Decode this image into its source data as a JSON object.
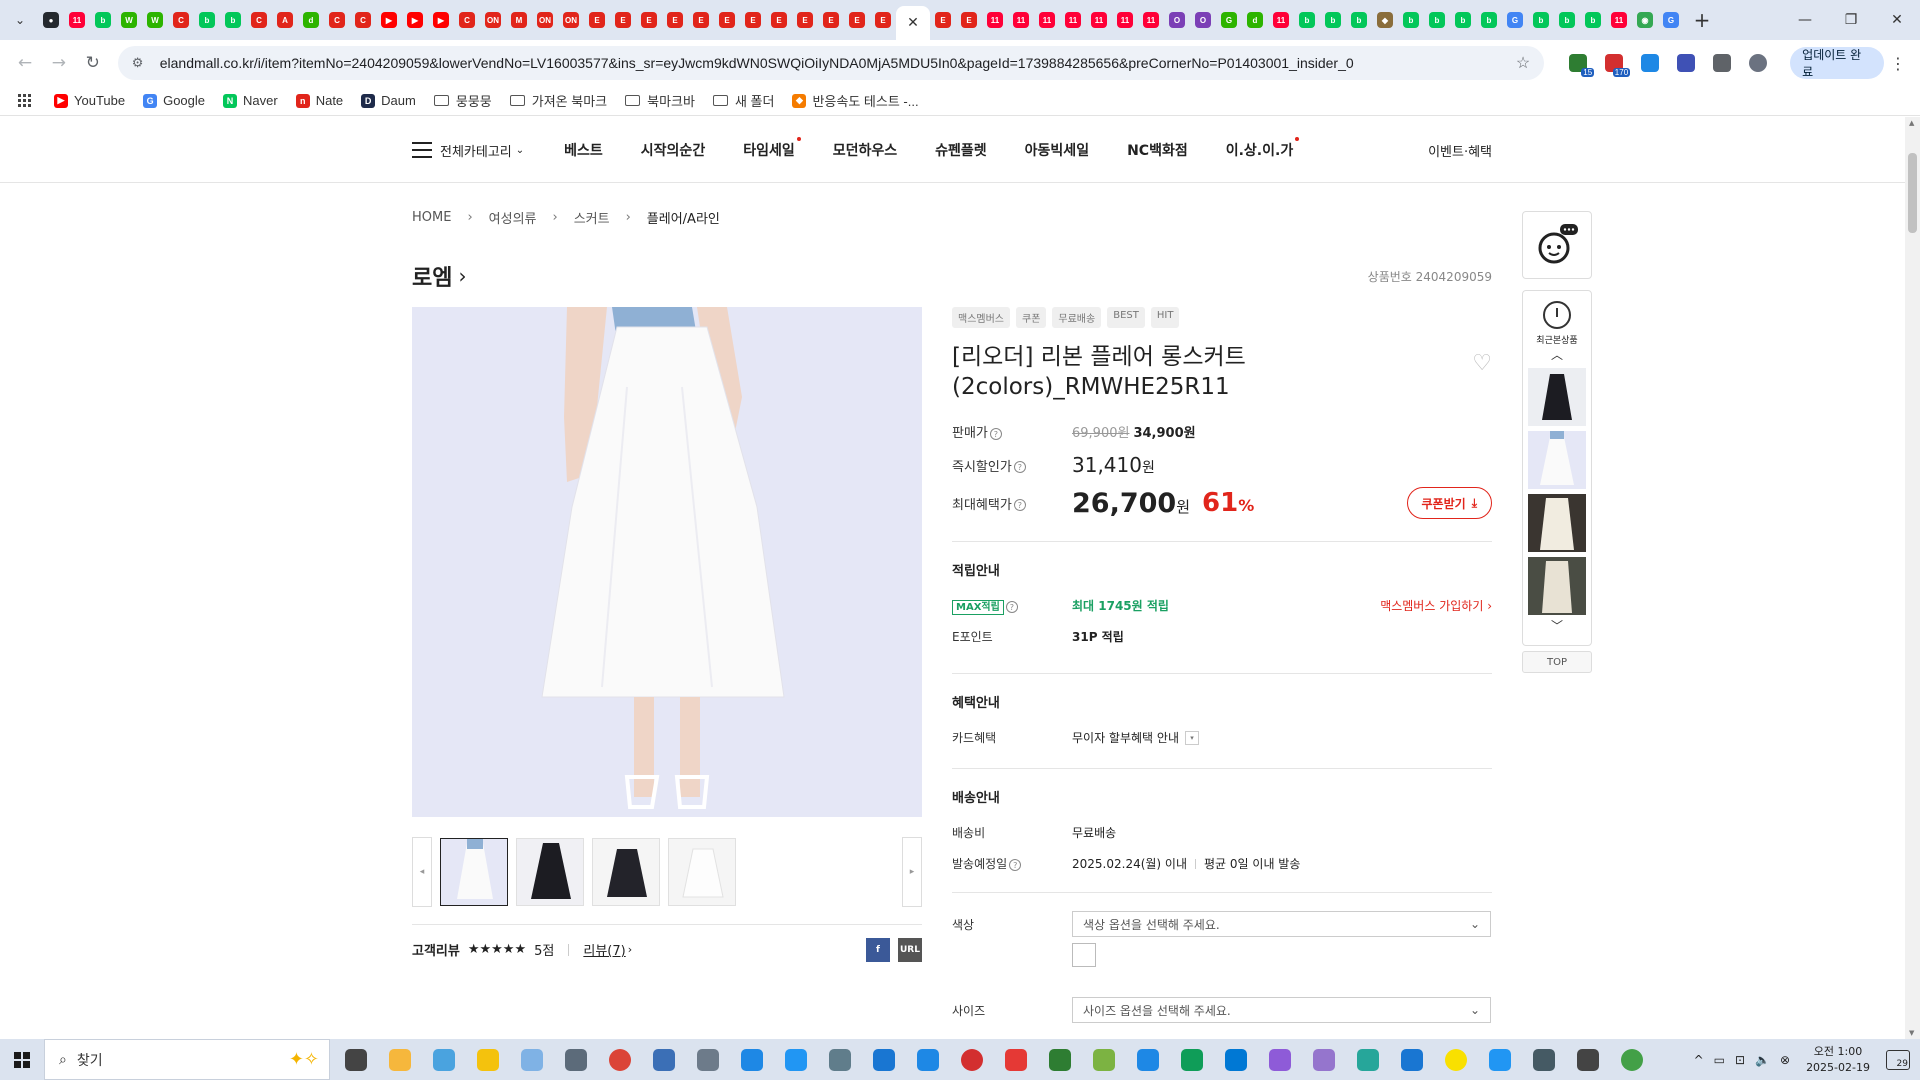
{
  "browser": {
    "tabs": [
      {
        "icon": "github-icon",
        "color": "#24292f",
        "active": false
      },
      {
        "icon": "11st-icon",
        "color": "#ff0038",
        "active": false
      },
      {
        "icon": "naver-blog-icon",
        "color": "#03c75a",
        "active": false
      },
      {
        "icon": "w-icon",
        "color": "#2db400",
        "active": false
      },
      {
        "icon": "w-icon",
        "color": "#2db400",
        "active": false
      },
      {
        "icon": "c-icon",
        "color": "#e1251b",
        "active": false
      },
      {
        "icon": "naver-blog-icon",
        "color": "#03c75a",
        "active": false
      },
      {
        "icon": "naver-blog-icon",
        "color": "#03c75a",
        "active": false
      },
      {
        "icon": "c-icon",
        "color": "#e1251b",
        "active": false
      },
      {
        "icon": "a-icon",
        "color": "#e1251b",
        "active": false
      },
      {
        "icon": "d-icon",
        "color": "#2db400",
        "active": false
      },
      {
        "icon": "c-icon",
        "color": "#e1251b",
        "active": false
      },
      {
        "icon": "c-icon",
        "color": "#e1251b",
        "active": false
      },
      {
        "icon": "youtube-icon",
        "color": "#ff0000",
        "active": false
      },
      {
        "icon": "youtube-icon",
        "color": "#ff0000",
        "active": false
      },
      {
        "icon": "youtube-icon",
        "color": "#ff0000",
        "active": false
      },
      {
        "icon": "c-icon",
        "color": "#e1251b",
        "active": false
      },
      {
        "icon": "on-icon",
        "color": "#e1251b",
        "active": false
      },
      {
        "icon": "m-icon",
        "color": "#e1251b",
        "active": false
      },
      {
        "icon": "on-icon",
        "color": "#e1251b",
        "active": false
      },
      {
        "icon": "on-icon",
        "color": "#e1251b",
        "active": false
      },
      {
        "icon": "elandmall-icon",
        "color": "#e1251b",
        "active": false
      },
      {
        "icon": "elandmall-icon",
        "color": "#e1251b",
        "active": false
      },
      {
        "icon": "elandmall-icon",
        "color": "#e1251b",
        "active": false
      },
      {
        "icon": "elandmall-icon",
        "color": "#e1251b",
        "active": false
      },
      {
        "icon": "elandmall-icon",
        "color": "#e1251b",
        "active": false
      },
      {
        "icon": "elandmall-icon",
        "color": "#e1251b",
        "active": false
      },
      {
        "icon": "elandmall-icon",
        "color": "#e1251b",
        "active": false
      },
      {
        "icon": "elandmall-icon",
        "color": "#e1251b",
        "active": false
      },
      {
        "icon": "elandmall-icon",
        "color": "#e1251b",
        "active": false
      },
      {
        "icon": "elandmall-icon",
        "color": "#e1251b",
        "active": false
      },
      {
        "icon": "elandmall-icon",
        "color": "#e1251b",
        "active": false
      },
      {
        "icon": "elandmall-icon",
        "color": "#e1251b",
        "active": false
      },
      {
        "icon": "close-icon",
        "color": "#333333",
        "active": true
      },
      {
        "icon": "elandmall-icon",
        "color": "#e1251b",
        "active": false
      },
      {
        "icon": "elandmall-icon",
        "color": "#e1251b",
        "active": false
      },
      {
        "icon": "11st-icon",
        "color": "#ff0038",
        "active": false
      },
      {
        "icon": "11st-icon",
        "color": "#ff0038",
        "active": false
      },
      {
        "icon": "11st-icon",
        "color": "#ff0038",
        "active": false
      },
      {
        "icon": "11st-icon",
        "color": "#ff0038",
        "active": false
      },
      {
        "icon": "11st-icon",
        "color": "#ff0038",
        "active": false
      },
      {
        "icon": "11st-icon",
        "color": "#ff0038",
        "active": false
      },
      {
        "icon": "11st-icon",
        "color": "#ff0038",
        "active": false
      },
      {
        "icon": "o-icon",
        "color": "#7b3fb6",
        "active": false
      },
      {
        "icon": "o-icon",
        "color": "#7b3fb6",
        "active": false
      },
      {
        "icon": "g-icon",
        "color": "#2db400",
        "active": false
      },
      {
        "icon": "d-icon",
        "color": "#2db400",
        "active": false
      },
      {
        "icon": "11st-icon",
        "color": "#ff0038",
        "active": false
      },
      {
        "icon": "naver-blog-icon",
        "color": "#03c75a",
        "active": false
      },
      {
        "icon": "naver-blog-icon",
        "color": "#03c75a",
        "active": false
      },
      {
        "icon": "naver-blog-icon",
        "color": "#03c75a",
        "active": false
      },
      {
        "icon": "owl-icon",
        "color": "#8a6d3b",
        "active": false
      },
      {
        "icon": "naver-blog-icon",
        "color": "#03c75a",
        "active": false
      },
      {
        "icon": "naver-blog-icon",
        "color": "#03c75a",
        "active": false
      },
      {
        "icon": "naver-blog-icon",
        "color": "#03c75a",
        "active": false
      },
      {
        "icon": "naver-blog-icon",
        "color": "#03c75a",
        "active": false
      },
      {
        "icon": "google-icon",
        "color": "#4285f4",
        "active": false
      },
      {
        "icon": "naver-blog-icon",
        "color": "#03c75a",
        "active": false
      },
      {
        "icon": "naver-blog-icon",
        "color": "#03c75a",
        "active": false
      },
      {
        "icon": "naver-blog-icon",
        "color": "#03c75a",
        "active": false
      },
      {
        "icon": "11st-icon",
        "color": "#ff0038",
        "active": false
      },
      {
        "icon": "maps-icon",
        "color": "#34a853",
        "active": false
      },
      {
        "icon": "google-icon",
        "color": "#4285f4",
        "active": false
      }
    ],
    "new_tab": "+",
    "window_controls": {
      "minimize": "—",
      "restore": "❐",
      "close": "✕"
    },
    "url": "elandmall.co.kr/i/item?itemNo=2404209059&lowerVendNo=LV16003577&ins_sr=eyJwcm9kdWN0SWQiOiIyNDA0MjA5MDU5In0&pageId=1739884285656&preCornerNo=P01403001_insider_0",
    "extensions": [
      {
        "icon": "ext-green-icon",
        "badge": "15",
        "color": "#2e7d32"
      },
      {
        "icon": "ext-red-icon",
        "badge": "170",
        "color": "#d32f2f"
      },
      {
        "icon": "ext-blue-icon",
        "badge": "",
        "color": "#1e88e5"
      },
      {
        "icon": "ext-translate-icon",
        "badge": "",
        "color": "#3f51b5"
      },
      {
        "icon": "puzzle-icon",
        "badge": "",
        "color": "#5f6368"
      },
      {
        "icon": "profile-icon",
        "badge": "",
        "color": "#5f6368"
      }
    ],
    "update_label": "업데이트 완료",
    "bookmarks": [
      {
        "label": "YouTube",
        "icon": "youtube-icon",
        "color": "#ff0000",
        "folder": false
      },
      {
        "label": "Google",
        "icon": "google-icon",
        "color": "#4285f4",
        "folder": false
      },
      {
        "label": "Naver",
        "icon": "naver-icon",
        "color": "#03c75a",
        "folder": false
      },
      {
        "label": "Nate",
        "icon": "nate-icon",
        "color": "#e1251b",
        "folder": false
      },
      {
        "label": "Daum",
        "icon": "daum-icon",
        "color": "#1e2a4a",
        "folder": false
      },
      {
        "label": "뭉뭉뭉",
        "icon": "folder-icon",
        "color": "",
        "folder": true
      },
      {
        "label": "가져온 북마크",
        "icon": "folder-icon",
        "color": "",
        "folder": true
      },
      {
        "label": "북마크바",
        "icon": "folder-icon",
        "color": "",
        "folder": true
      },
      {
        "label": "새 폴더",
        "icon": "folder-icon",
        "color": "",
        "folder": true
      },
      {
        "label": "반응속도 테스트 -...",
        "icon": "fox-icon",
        "color": "#f57c00",
        "folder": false
      }
    ]
  },
  "site": {
    "nav": {
      "all_category": "전체카테고리",
      "items": [
        {
          "label": "베스트",
          "dot": false
        },
        {
          "label": "시작의순간",
          "dot": false
        },
        {
          "label": "타임세일",
          "dot": true
        },
        {
          "label": "모던하우스",
          "dot": false
        },
        {
          "label": "슈펜플렛",
          "dot": false
        },
        {
          "label": "아동빅세일",
          "dot": false
        },
        {
          "label": "NC백화점",
          "dot": false
        },
        {
          "label": "이.상.이.가",
          "dot": true
        }
      ],
      "event": "이벤트·혜택"
    },
    "breadcrumb": [
      "HOME",
      "여성의류",
      "스커트",
      "플레어/A라인"
    ],
    "brand": "로엠",
    "product_no": "상품번호 2404209059",
    "tags": [
      "맥스멤버스",
      "쿠폰",
      "무료배송",
      "BEST",
      "HIT"
    ],
    "product_name": "[리오더] 리본 플레어 롱스커트 (2colors)_RMWHE25R11",
    "price": {
      "sale_label": "판매가",
      "original": "69,900원",
      "sale": "34,900원",
      "instant_label": "즉시할인가",
      "instant_value": "31,410",
      "instant_unit": "원",
      "max_label": "최대혜택가",
      "max_value": "26,700",
      "max_unit": "원",
      "discount_value": "61",
      "discount_unit": "%",
      "coupon_btn": "쿠폰받기"
    },
    "points": {
      "title": "적립안내",
      "max_badge": "MAX적립",
      "max_text": "최대 1745원 적립",
      "join_link": "맥스멤버스 가입하기",
      "epoint_label": "E포인트",
      "epoint_value": "31P 적립"
    },
    "benefit": {
      "title": "혜택안내",
      "card_label": "카드혜택",
      "card_value": "무이자 할부혜택 안내"
    },
    "delivery": {
      "title": "배송안내",
      "fee_label": "배송비",
      "fee_value": "무료배송",
      "date_label": "발송예정일",
      "date_value": "2025.02.24(월) 이내",
      "date_avg": "평균 0일 이내 발송"
    },
    "options": {
      "color_label": "색상",
      "color_placeholder": "색상 옵션을 선택해 주세요.",
      "size_label": "사이즈",
      "size_placeholder": "사이즈 옵션을 선택해 주세요."
    },
    "review": {
      "label": "고객리뷰",
      "rating": 5,
      "stars": "★★★★★",
      "score": "5점",
      "link": "리뷰(7)"
    },
    "share": [
      {
        "icon": "facebook-icon",
        "label": "f",
        "color": "#3b5998"
      },
      {
        "icon": "url-icon",
        "label": "URL",
        "color": "#555555"
      }
    ],
    "recent_label": "최근본상품",
    "top_label": "TOP"
  },
  "taskbar": {
    "search_placeholder": "찾기",
    "apps": [
      {
        "icon": "task-view-icon",
        "color": "#444444"
      },
      {
        "icon": "file-explorer-icon",
        "color": "#f6b73c"
      },
      {
        "icon": "app-icon",
        "color": "#4aa3df"
      },
      {
        "icon": "media-player-icon",
        "color": "#f4c20d"
      },
      {
        "icon": "paint-icon",
        "color": "#7fb2e5"
      },
      {
        "icon": "calculator-icon",
        "color": "#5c6b7a"
      },
      {
        "icon": "chrome-icon",
        "color": "#db4437"
      },
      {
        "icon": "app-icon",
        "color": "#3b6fb6"
      },
      {
        "icon": "app-icon",
        "color": "#6d7b8a"
      },
      {
        "icon": "app-icon",
        "color": "#1e88e5"
      },
      {
        "icon": "app-icon",
        "color": "#2196f3"
      },
      {
        "icon": "app-icon",
        "color": "#607d8b"
      },
      {
        "icon": "app-icon",
        "color": "#1976d2"
      },
      {
        "icon": "app-icon",
        "color": "#1e88e5"
      },
      {
        "icon": "record-icon",
        "color": "#d32f2f"
      },
      {
        "icon": "app-icon",
        "color": "#e53935"
      },
      {
        "icon": "app-icon",
        "color": "#2e7d32"
      },
      {
        "icon": "app-icon",
        "color": "#7cb342"
      },
      {
        "icon": "app-icon",
        "color": "#1e88e5"
      },
      {
        "icon": "edge-icon",
        "color": "#0f9d58"
      },
      {
        "icon": "outlook-icon",
        "color": "#0078d4"
      },
      {
        "icon": "copilot-icon",
        "color": "#8e5bd8"
      },
      {
        "icon": "app-icon",
        "color": "#9575cd"
      },
      {
        "icon": "app-icon",
        "color": "#26a69a"
      },
      {
        "icon": "app-icon",
        "color": "#1976d2"
      },
      {
        "icon": "kakaotalk-icon",
        "color": "#f9e000"
      },
      {
        "icon": "app-icon",
        "color": "#2196f3"
      },
      {
        "icon": "app-icon",
        "color": "#455a64"
      },
      {
        "icon": "settings-icon",
        "color": "#444444"
      },
      {
        "icon": "onedrive-icon",
        "color": "#43a047"
      }
    ],
    "time": "오전 1:00",
    "date": "2025-02-19",
    "notifications": "29"
  }
}
